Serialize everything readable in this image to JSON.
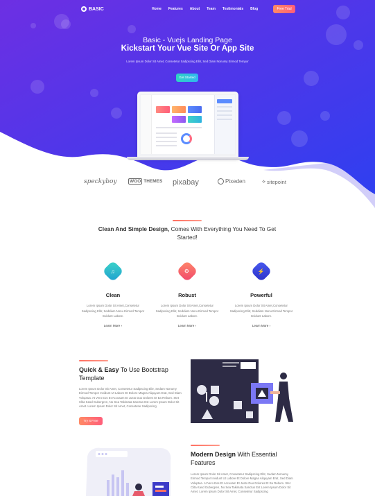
{
  "nav": {
    "logo": "BASIC",
    "links": [
      "Home",
      "Features",
      "About",
      "Team",
      "Testimonials",
      "Blog"
    ],
    "cta": "Free Trial"
  },
  "hero": {
    "subtitle": "Basic - Vuejs Landing Page",
    "title": "Kickstart Your Vue Site Or App Site",
    "description": "Lorem Ipsum Dolor Sit Amet, Consetetur Sadipscing Elitr, Sed Diam Nonumy Eirmod Tempor",
    "button": "Get Started"
  },
  "brands": {
    "speckyboy": "speckyboy",
    "woo_box": "WOO",
    "woo_rest": "THEMES",
    "pixabay": "pixabay",
    "pixeden": "Pixeden",
    "sitepoint": "sitepoint"
  },
  "intro": {
    "bold": "Clean And Simple Design,",
    "rest": " Comes With Everything You Need To Get Started!"
  },
  "features": [
    {
      "title": "Clean",
      "icon": "music-note-icon",
      "color": "#21b8c4",
      "description": "Lorem Ipsum Dolor Sit Amet,Consetetur Sadipscing Elitr, Seddiam Nonu Eirmod Tempor Invidunt Labore.",
      "link": "Learn More"
    },
    {
      "title": "Robust",
      "icon": "gear-icon",
      "color": "#f4566b",
      "description": "Lorem Ipsum Dolor Sit Amet,Consetetur Sadipscing Elitr, Seddiam Nonu Eirmod Tempor Invidunt Labore.",
      "link": "Learn More"
    },
    {
      "title": "Powerful",
      "icon": "lightning-icon",
      "color": "#3344e0",
      "description": "Lorem Ipsum Dolor Sit Amet,Consetetur Sadipscing Elitr, Seddiam Nonu Eirmod Tempor Invidunt Labore.",
      "link": "Learn More"
    }
  ],
  "quick": {
    "title_bold": "Quick & Easy",
    "title_rest": " To Use Bootstrap Template",
    "description": "Lorem Ipsum Dolor Sit Amet, Consetetur Sadipscing Elitr, Sedam Nonumy Eirmod Tempor Invidunt Ut Labore Et Dolore Magna Aliquyam Erat, Sed Diam Voluptua. At Vero Eos Et Accusam Et Justo Duo Dolores Et Ea Rebum. Stet Clita Kasd Gubergren, No Sea Takimata Sanctus Est Lorem Ipsum Dolor Sit Amet. Lorem Ipsum Dolor Sit Amet, Consetetur Sadipscing",
    "button": "Try It Free"
  },
  "modern": {
    "title_bold": "Modern Design",
    "title_rest": " With Essential Features",
    "description": "Lorem Ipsum Dolor Sit Amet, Consetetur Sadipscing Elitr, Sedam Nonumy Eirmod Tempor Invidunt Ut Labore Et Dolore Magna Aliquyam Erat, Sed Diam Voluptua. At Vero Eos Et Accusam Et Justo Duo Dolores Et Ea Rebum. Stet Clita Kasd Gubergren, No Sea Takimata Sanctus Est Lorem Ipsum Dolor Sit Amet. Lorem Ipsum Dolor Sit Amet, Consetetur Sadipscing"
  },
  "colors": {
    "hero_start": "#6d2fe3",
    "hero_end": "#2f3ff0",
    "accent": "#ff6f61"
  }
}
